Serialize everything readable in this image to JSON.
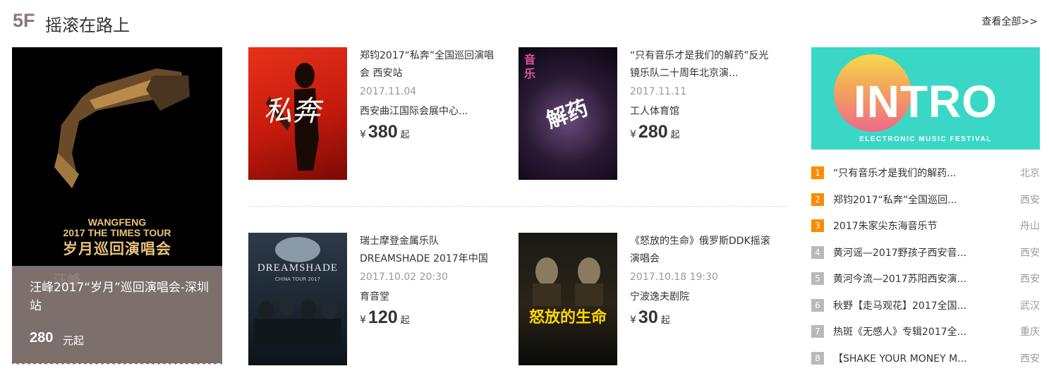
{
  "header": {
    "floor": "5F",
    "title": "摇滚在路上",
    "view_all": "查看全部>>"
  },
  "feature": {
    "poster_line1": "WANGFENG",
    "poster_line2": "2017 THE TIMES TOUR",
    "poster_line3": "岁月巡回演唱会",
    "ghost_text": "汪峰",
    "name": "汪峰2017“岁月”巡回演唱会-深圳站",
    "price": "280",
    "price_suffix": "元起"
  },
  "events": [
    {
      "title": "郑钧2017“私奔”全国巡回演唱会 西安站",
      "date": "2017.11.04",
      "venue": "西安曲江国际会展中心...",
      "yen": "¥",
      "price": "380",
      "suffix": "起",
      "poster_text": "私奔"
    },
    {
      "title": "“只有音乐才是我们的解药”反光镜乐队二十周年北京演...",
      "date": "2017.11.11",
      "venue": "工人体育馆",
      "yen": "¥",
      "price": "280",
      "suffix": "起",
      "poster_text": "解药"
    },
    {
      "title": "瑞士摩登金属乐队DREAMSHADE 2017年中国",
      "date": "2017.10.02 20:30",
      "venue": "育音堂",
      "yen": "¥",
      "price": "120",
      "suffix": "起",
      "poster_text": "DREAMSHADE",
      "poster_sub": "CHINA TOUR 2017"
    },
    {
      "title": "《怒放的生命》俄罗斯DDK摇滚演唱会",
      "date": "2017.10.18 19:30",
      "venue": "宁波逸夫剧院",
      "yen": "¥",
      "price": "30",
      "suffix": "起",
      "poster_text": "怒放的生命"
    }
  ],
  "banner": {
    "title": "INTRO",
    "subtitle": "ELECTRONIC MUSIC FESTIVAL"
  },
  "ranking": [
    {
      "num": "1",
      "name": "“只有音乐才是我们的解药...",
      "city": "北京"
    },
    {
      "num": "2",
      "name": "郑钧2017“私奔”全国巡回...",
      "city": "西安"
    },
    {
      "num": "3",
      "name": "2017朱家尖东海音乐节",
      "city": "舟山"
    },
    {
      "num": "4",
      "name": "黄河谣—2017野孩子西安音...",
      "city": "西安"
    },
    {
      "num": "5",
      "name": "黄河今流—2017苏阳西安演...",
      "city": "西安"
    },
    {
      "num": "6",
      "name": "秋野【走马观花】2017全国...",
      "city": "武汉"
    },
    {
      "num": "7",
      "name": "热斑《无感人》专辑2017全...",
      "city": "重庆"
    },
    {
      "num": "8",
      "name": "【SHAKE YOUR MONEY M...",
      "city": "西安"
    }
  ],
  "colors": {
    "accent_orange": "#ff8a00",
    "rank_gray": "#b9b9b9",
    "feature_bg": "#7c6f6c",
    "banner_bg": "#3ad7c6"
  }
}
